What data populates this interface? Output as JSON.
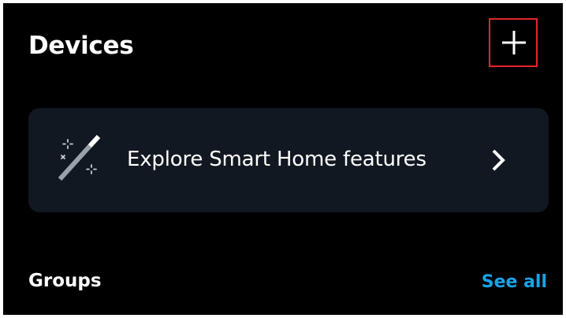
{
  "header": {
    "title": "Devices",
    "add_button_icon": "plus-icon",
    "highlight_color": "#e3262b"
  },
  "explore_card": {
    "icon": "magic-wand-icon",
    "label": "Explore Smart Home features",
    "chevron_icon": "chevron-right-icon",
    "background": "#111821"
  },
  "groups_section": {
    "title": "Groups",
    "see_all_label": "See all",
    "link_color": "#1ba3e8"
  },
  "theme": {
    "background": "#000000",
    "text": "#ffffff"
  }
}
